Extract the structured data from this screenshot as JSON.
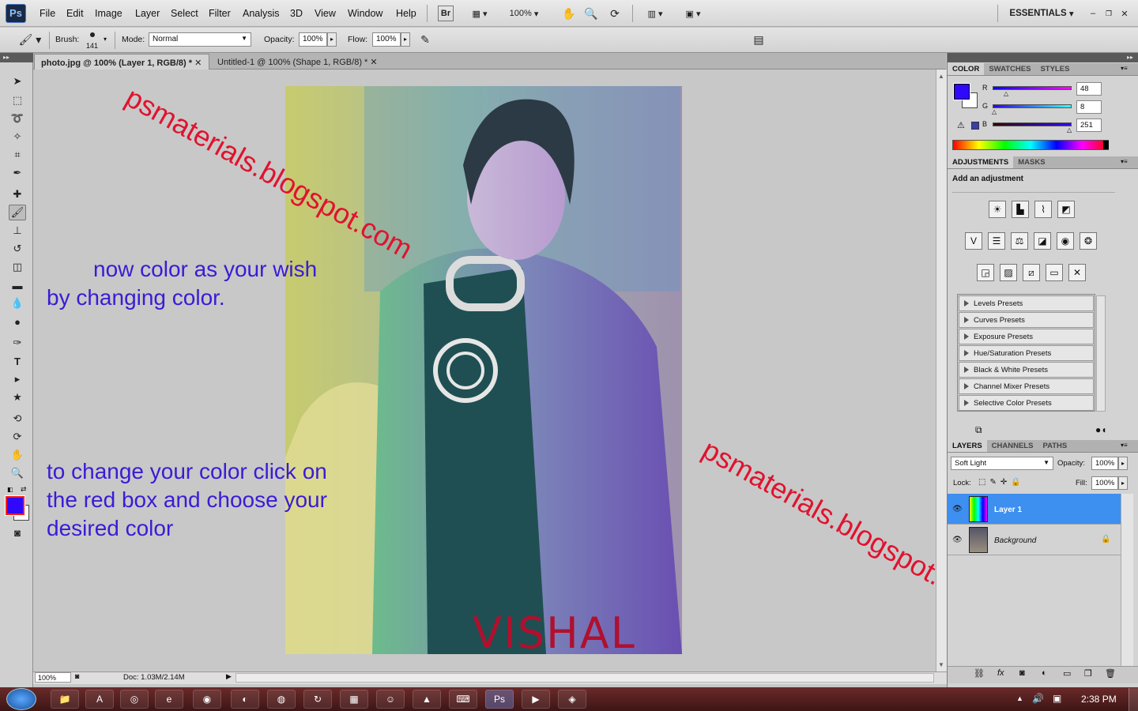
{
  "app": {
    "logo": "Ps",
    "menu": [
      "File",
      "Edit",
      "Image",
      "Layer",
      "Select",
      "Filter",
      "Analysis",
      "3D",
      "View",
      "Window",
      "Help"
    ],
    "zoom": "100%",
    "workspace": "ESSENTIALS"
  },
  "options": {
    "brush_label": "Brush:",
    "brush_size": "141",
    "mode_label": "Mode:",
    "mode_value": "Normal",
    "opacity_label": "Opacity:",
    "opacity_value": "100%",
    "flow_label": "Flow:",
    "flow_value": "100%"
  },
  "tabs": [
    {
      "label": "photo.jpg @ 100% (Layer 1, RGB/8) *",
      "active": true
    },
    {
      "label": "Untitled-1 @ 100% (Shape 1, RGB/8) *",
      "active": false
    }
  ],
  "canvas": {
    "annotation_1_line1": "now  color  as your wish",
    "annotation_1_line2": "by changing color.",
    "annotation_2_line1": "to change your color click on",
    "annotation_2_line2": "the red box and choose your",
    "annotation_2_line3": "desired color",
    "watermark": "psmaterials.blogspot.com",
    "photo_signature": "VISHAL"
  },
  "status": {
    "zoom": "100%",
    "doc": "Doc: 1.03M/2.14M"
  },
  "color_panel": {
    "tabs": [
      "COLOR",
      "SWATCHES",
      "STYLES"
    ],
    "r_label": "R",
    "r_value": "48",
    "g_label": "G",
    "g_value": "8",
    "b_label": "B",
    "b_value": "251",
    "foreground_color": "#3008fb"
  },
  "adjustments_panel": {
    "tabs": [
      "ADJUSTMENTS",
      "MASKS"
    ],
    "title": "Add an adjustment",
    "presets": [
      "Levels Presets",
      "Curves Presets",
      "Exposure Presets",
      "Hue/Saturation Presets",
      "Black & White Presets",
      "Channel Mixer Presets",
      "Selective Color Presets"
    ]
  },
  "layers_panel": {
    "tabs": [
      "LAYERS",
      "CHANNELS",
      "PATHS"
    ],
    "blend_mode": "Soft Light",
    "opacity_label": "Opacity:",
    "opacity_value": "100%",
    "lock_label": "Lock:",
    "fill_label": "Fill:",
    "fill_value": "100%",
    "layers": [
      {
        "name": "Layer 1",
        "selected": true
      },
      {
        "name": "Background",
        "selected": false
      }
    ]
  },
  "taskbar": {
    "clock": "2:38 PM"
  }
}
